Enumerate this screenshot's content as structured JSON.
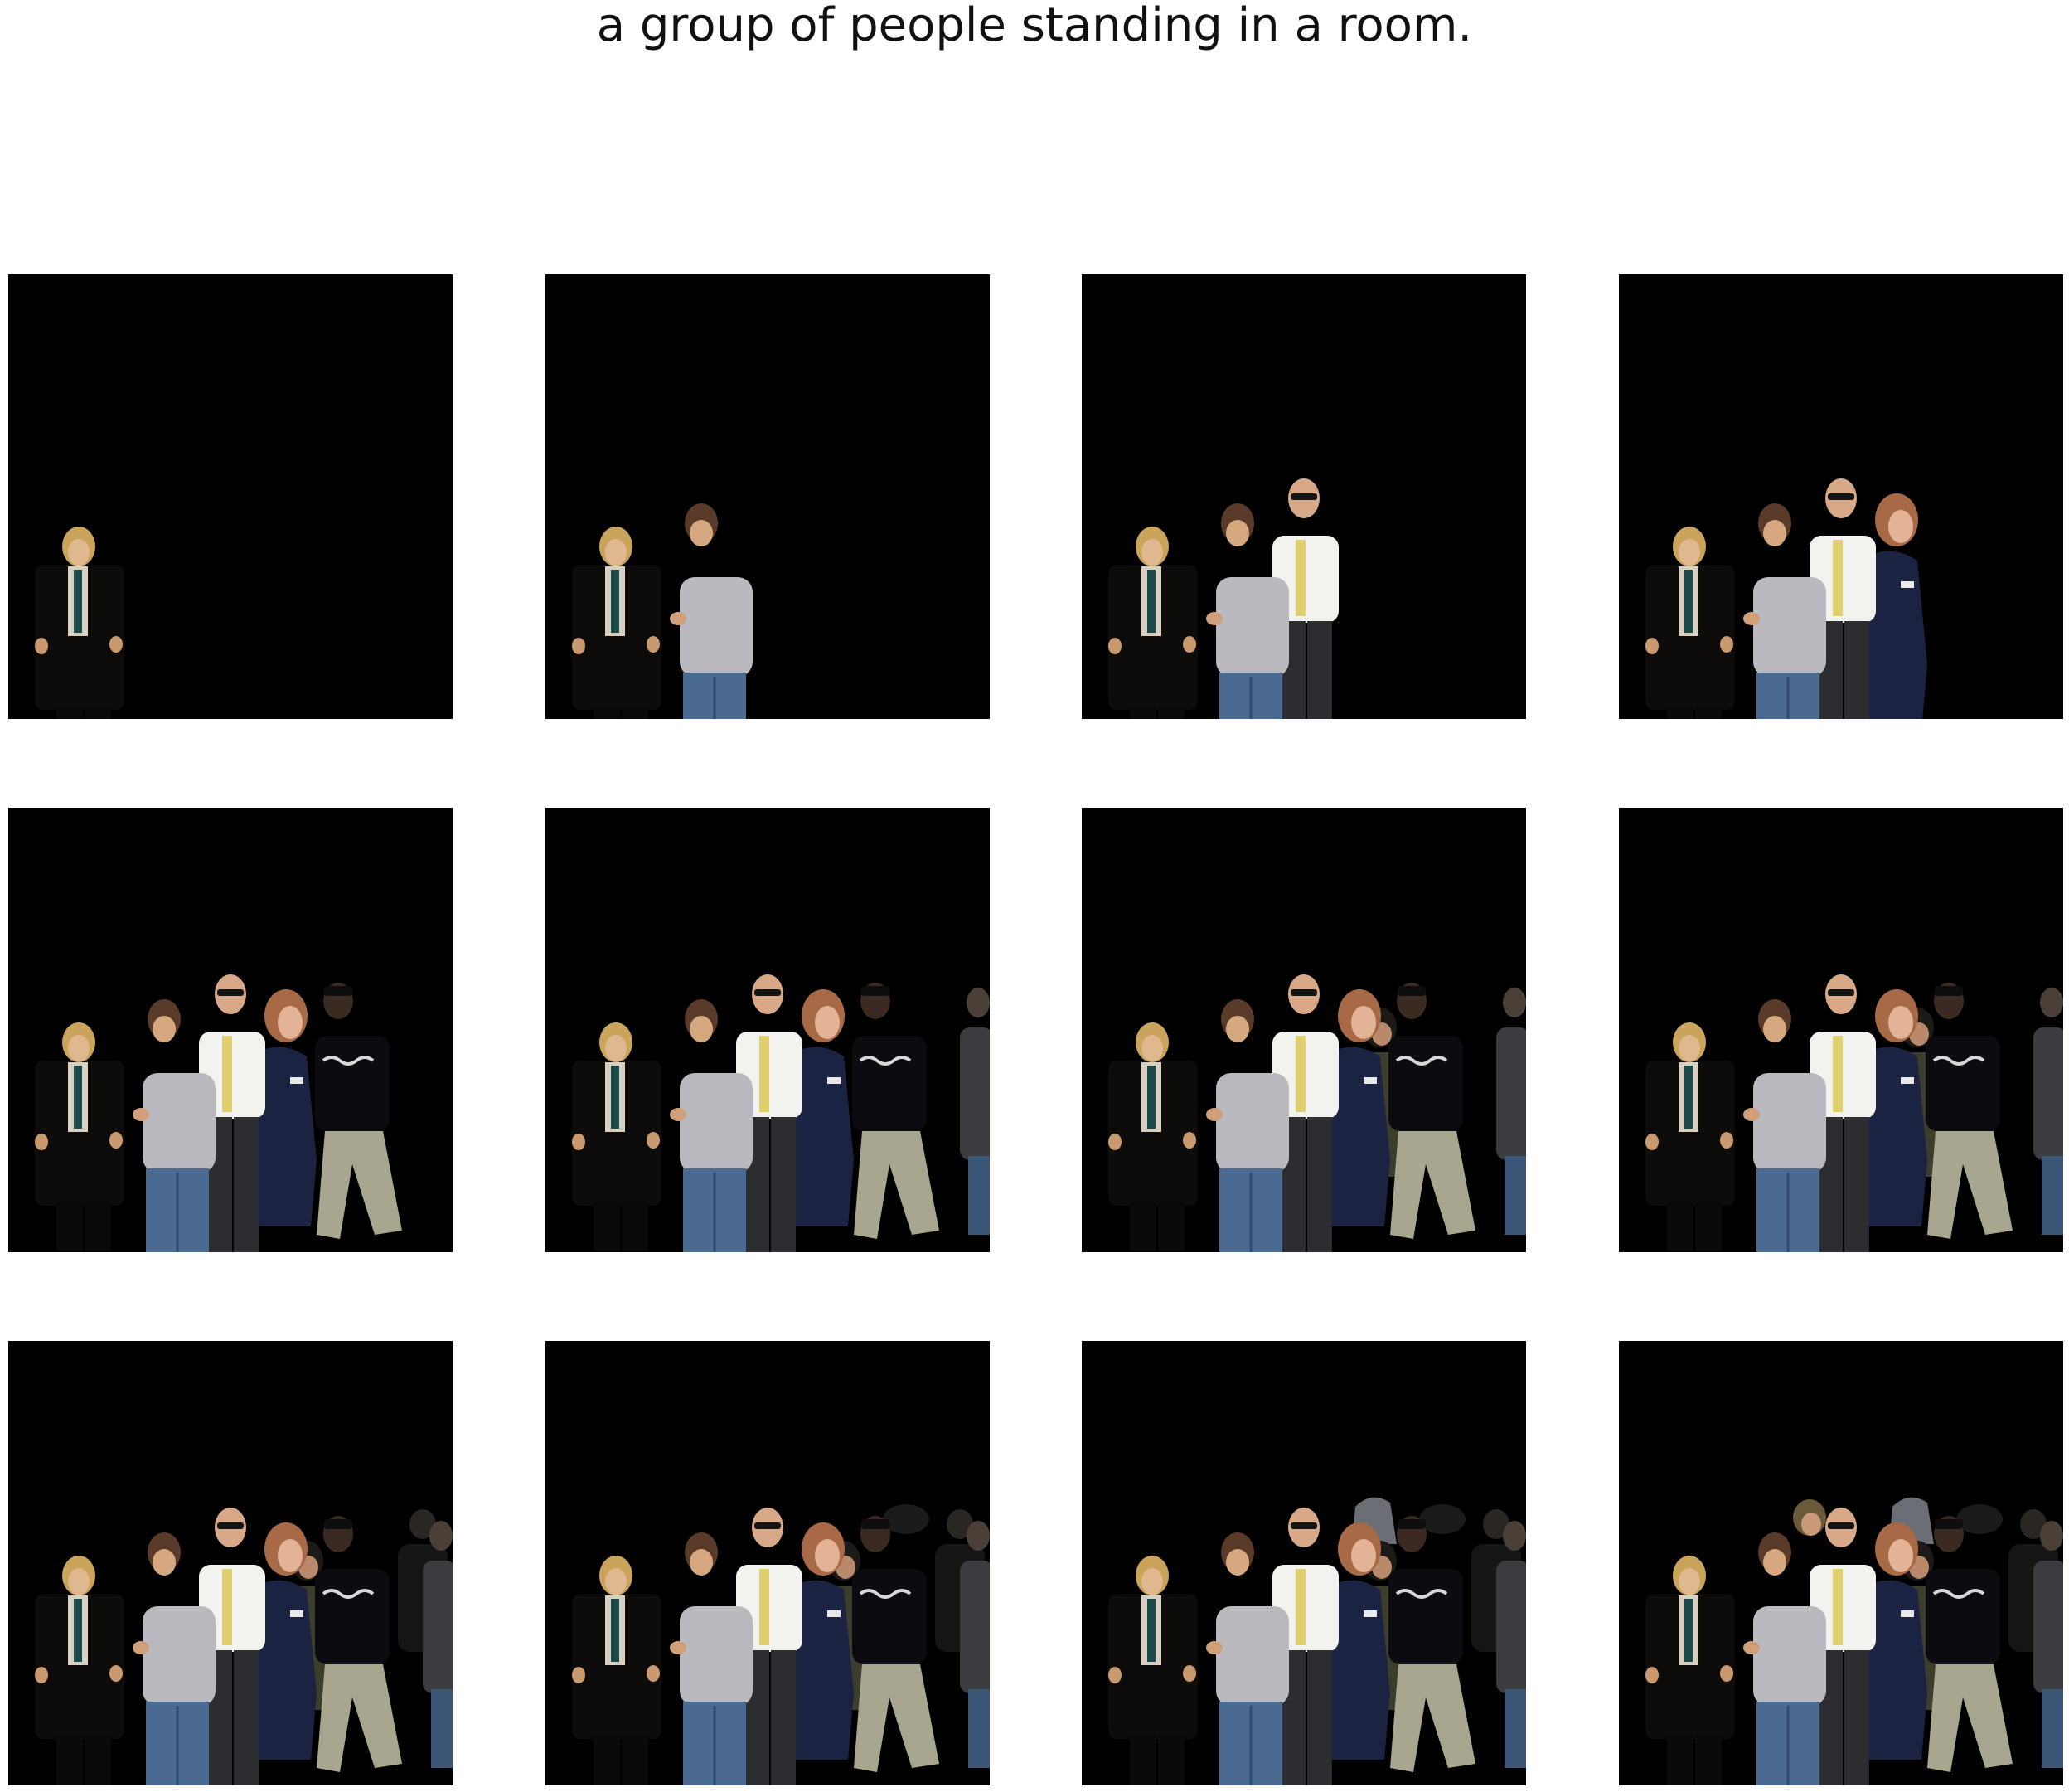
{
  "caption": "a group of people standing in a room.",
  "colors": {
    "page_background": "#ffffff",
    "panel_background": "#000000",
    "caption_text": "#111111"
  },
  "grid": {
    "rows": 3,
    "columns": 4,
    "panels": [
      {
        "figures": [
          "blonde-man-in-black-suit"
        ]
      },
      {
        "figures": [
          "blonde-man-in-black-suit",
          "man-in-grey-hoodie"
        ]
      },
      {
        "figures": [
          "blonde-man-in-black-suit",
          "man-in-grey-hoodie",
          "man-in-white-shirt-and-tie"
        ]
      },
      {
        "figures": [
          "blonde-man-in-black-suit",
          "man-in-grey-hoodie",
          "man-in-white-shirt-and-tie",
          "woman-in-navy"
        ]
      },
      {
        "figures": [
          "blonde-man-in-black-suit",
          "man-in-grey-hoodie",
          "man-in-white-shirt-and-tie",
          "woman-in-navy",
          "man-in-black-top-and-khakis"
        ]
      },
      {
        "figures": [
          "blonde-man-in-black-suit",
          "man-in-grey-hoodie",
          "man-in-white-shirt-and-tie",
          "woman-in-navy",
          "man-in-black-top-and-khakis",
          "man-at-edge-in-dark-jacket"
        ]
      },
      {
        "figures": [
          "blonde-man-in-black-suit",
          "man-in-grey-hoodie",
          "man-in-white-shirt-and-tie",
          "woman-in-navy",
          "man-in-black-top-and-khakis",
          "man-at-edge-in-dark-jacket",
          "person-in-olive-jacket"
        ]
      },
      {
        "figures": [
          "blonde-man-in-black-suit",
          "man-in-grey-hoodie",
          "man-in-white-shirt-and-tie",
          "woman-in-navy",
          "man-in-black-top-and-khakis",
          "man-at-edge-in-dark-jacket",
          "person-in-olive-jacket",
          "person-with-white-scarf"
        ]
      },
      {
        "figures": [
          "blonde-man-in-black-suit",
          "man-in-grey-hoodie",
          "man-in-white-shirt-and-tie",
          "woman-in-navy",
          "man-in-black-top-and-khakis",
          "man-at-edge-in-dark-jacket",
          "person-in-olive-jacket",
          "person-with-white-scarf",
          "dark-figure-right"
        ]
      },
      {
        "figures": [
          "blonde-man-in-black-suit",
          "man-in-grey-hoodie",
          "man-in-white-shirt-and-tie",
          "woman-in-navy",
          "man-in-black-top-and-khakis",
          "man-at-edge-in-dark-jacket",
          "person-in-olive-jacket",
          "person-with-white-scarf",
          "dark-figure-right",
          "dark-figure-back"
        ]
      },
      {
        "figures": [
          "blonde-man-in-black-suit",
          "man-in-grey-hoodie",
          "man-in-white-shirt-and-tie",
          "woman-in-navy",
          "man-in-black-top-and-khakis",
          "man-at-edge-in-dark-jacket",
          "person-in-olive-jacket",
          "person-with-white-scarf",
          "dark-figure-right",
          "dark-figure-back",
          "grey-figure-back"
        ]
      },
      {
        "figures": [
          "blonde-man-in-black-suit",
          "man-in-grey-hoodie",
          "man-in-white-shirt-and-tie",
          "woman-in-navy",
          "man-in-black-top-and-khakis",
          "man-at-edge-in-dark-jacket",
          "person-in-olive-jacket",
          "person-with-white-scarf",
          "dark-figure-right",
          "dark-figure-back",
          "grey-figure-back",
          "head-in-back"
        ]
      }
    ]
  }
}
